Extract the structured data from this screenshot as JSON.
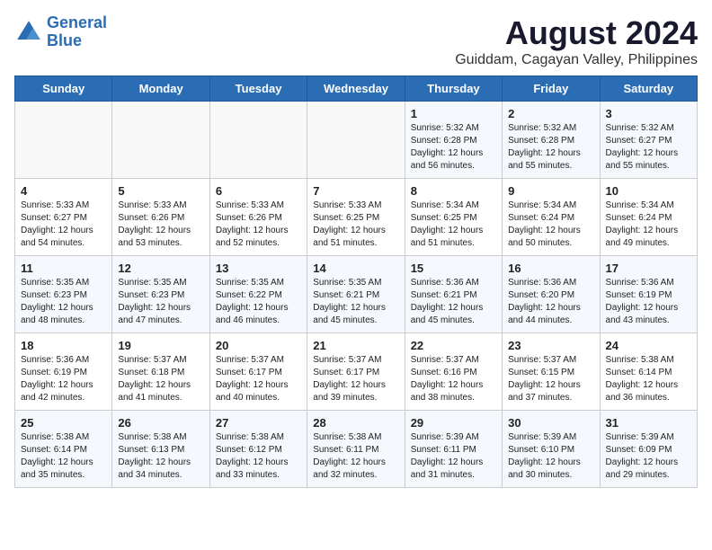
{
  "logo": {
    "line1": "General",
    "line2": "Blue"
  },
  "title": "August 2024",
  "subtitle": "Guiddam, Cagayan Valley, Philippines",
  "days_of_week": [
    "Sunday",
    "Monday",
    "Tuesday",
    "Wednesday",
    "Thursday",
    "Friday",
    "Saturday"
  ],
  "weeks": [
    [
      {
        "day": "",
        "info": ""
      },
      {
        "day": "",
        "info": ""
      },
      {
        "day": "",
        "info": ""
      },
      {
        "day": "",
        "info": ""
      },
      {
        "day": "1",
        "info": "Sunrise: 5:32 AM\nSunset: 6:28 PM\nDaylight: 12 hours\nand 56 minutes."
      },
      {
        "day": "2",
        "info": "Sunrise: 5:32 AM\nSunset: 6:28 PM\nDaylight: 12 hours\nand 55 minutes."
      },
      {
        "day": "3",
        "info": "Sunrise: 5:32 AM\nSunset: 6:27 PM\nDaylight: 12 hours\nand 55 minutes."
      }
    ],
    [
      {
        "day": "4",
        "info": "Sunrise: 5:33 AM\nSunset: 6:27 PM\nDaylight: 12 hours\nand 54 minutes."
      },
      {
        "day": "5",
        "info": "Sunrise: 5:33 AM\nSunset: 6:26 PM\nDaylight: 12 hours\nand 53 minutes."
      },
      {
        "day": "6",
        "info": "Sunrise: 5:33 AM\nSunset: 6:26 PM\nDaylight: 12 hours\nand 52 minutes."
      },
      {
        "day": "7",
        "info": "Sunrise: 5:33 AM\nSunset: 6:25 PM\nDaylight: 12 hours\nand 51 minutes."
      },
      {
        "day": "8",
        "info": "Sunrise: 5:34 AM\nSunset: 6:25 PM\nDaylight: 12 hours\nand 51 minutes."
      },
      {
        "day": "9",
        "info": "Sunrise: 5:34 AM\nSunset: 6:24 PM\nDaylight: 12 hours\nand 50 minutes."
      },
      {
        "day": "10",
        "info": "Sunrise: 5:34 AM\nSunset: 6:24 PM\nDaylight: 12 hours\nand 49 minutes."
      }
    ],
    [
      {
        "day": "11",
        "info": "Sunrise: 5:35 AM\nSunset: 6:23 PM\nDaylight: 12 hours\nand 48 minutes."
      },
      {
        "day": "12",
        "info": "Sunrise: 5:35 AM\nSunset: 6:23 PM\nDaylight: 12 hours\nand 47 minutes."
      },
      {
        "day": "13",
        "info": "Sunrise: 5:35 AM\nSunset: 6:22 PM\nDaylight: 12 hours\nand 46 minutes."
      },
      {
        "day": "14",
        "info": "Sunrise: 5:35 AM\nSunset: 6:21 PM\nDaylight: 12 hours\nand 45 minutes."
      },
      {
        "day": "15",
        "info": "Sunrise: 5:36 AM\nSunset: 6:21 PM\nDaylight: 12 hours\nand 45 minutes."
      },
      {
        "day": "16",
        "info": "Sunrise: 5:36 AM\nSunset: 6:20 PM\nDaylight: 12 hours\nand 44 minutes."
      },
      {
        "day": "17",
        "info": "Sunrise: 5:36 AM\nSunset: 6:19 PM\nDaylight: 12 hours\nand 43 minutes."
      }
    ],
    [
      {
        "day": "18",
        "info": "Sunrise: 5:36 AM\nSunset: 6:19 PM\nDaylight: 12 hours\nand 42 minutes."
      },
      {
        "day": "19",
        "info": "Sunrise: 5:37 AM\nSunset: 6:18 PM\nDaylight: 12 hours\nand 41 minutes."
      },
      {
        "day": "20",
        "info": "Sunrise: 5:37 AM\nSunset: 6:17 PM\nDaylight: 12 hours\nand 40 minutes."
      },
      {
        "day": "21",
        "info": "Sunrise: 5:37 AM\nSunset: 6:17 PM\nDaylight: 12 hours\nand 39 minutes."
      },
      {
        "day": "22",
        "info": "Sunrise: 5:37 AM\nSunset: 6:16 PM\nDaylight: 12 hours\nand 38 minutes."
      },
      {
        "day": "23",
        "info": "Sunrise: 5:37 AM\nSunset: 6:15 PM\nDaylight: 12 hours\nand 37 minutes."
      },
      {
        "day": "24",
        "info": "Sunrise: 5:38 AM\nSunset: 6:14 PM\nDaylight: 12 hours\nand 36 minutes."
      }
    ],
    [
      {
        "day": "25",
        "info": "Sunrise: 5:38 AM\nSunset: 6:14 PM\nDaylight: 12 hours\nand 35 minutes."
      },
      {
        "day": "26",
        "info": "Sunrise: 5:38 AM\nSunset: 6:13 PM\nDaylight: 12 hours\nand 34 minutes."
      },
      {
        "day": "27",
        "info": "Sunrise: 5:38 AM\nSunset: 6:12 PM\nDaylight: 12 hours\nand 33 minutes."
      },
      {
        "day": "28",
        "info": "Sunrise: 5:38 AM\nSunset: 6:11 PM\nDaylight: 12 hours\nand 32 minutes."
      },
      {
        "day": "29",
        "info": "Sunrise: 5:39 AM\nSunset: 6:11 PM\nDaylight: 12 hours\nand 31 minutes."
      },
      {
        "day": "30",
        "info": "Sunrise: 5:39 AM\nSunset: 6:10 PM\nDaylight: 12 hours\nand 30 minutes."
      },
      {
        "day": "31",
        "info": "Sunrise: 5:39 AM\nSunset: 6:09 PM\nDaylight: 12 hours\nand 29 minutes."
      }
    ]
  ]
}
